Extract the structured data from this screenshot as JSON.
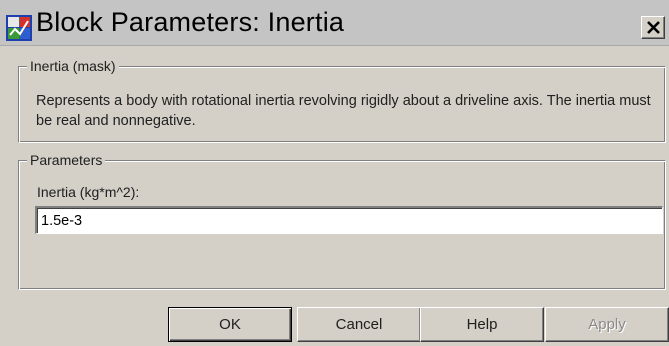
{
  "window": {
    "title": "Block Parameters: Inertia",
    "app_icon": "simulink-block-icon",
    "close_icon": "close-icon"
  },
  "mask_group": {
    "title": "Inertia (mask)",
    "description": "Represents a body with rotational inertia revolving rigidly about a driveline axis. The inertia must be real and nonnegative."
  },
  "parameters_group": {
    "title": "Parameters",
    "inertia_label": "Inertia (kg*m^2):",
    "inertia_value": "1.5e-3"
  },
  "buttons": {
    "ok": "OK",
    "cancel": "Cancel",
    "help": "Help",
    "apply": "Apply"
  }
}
